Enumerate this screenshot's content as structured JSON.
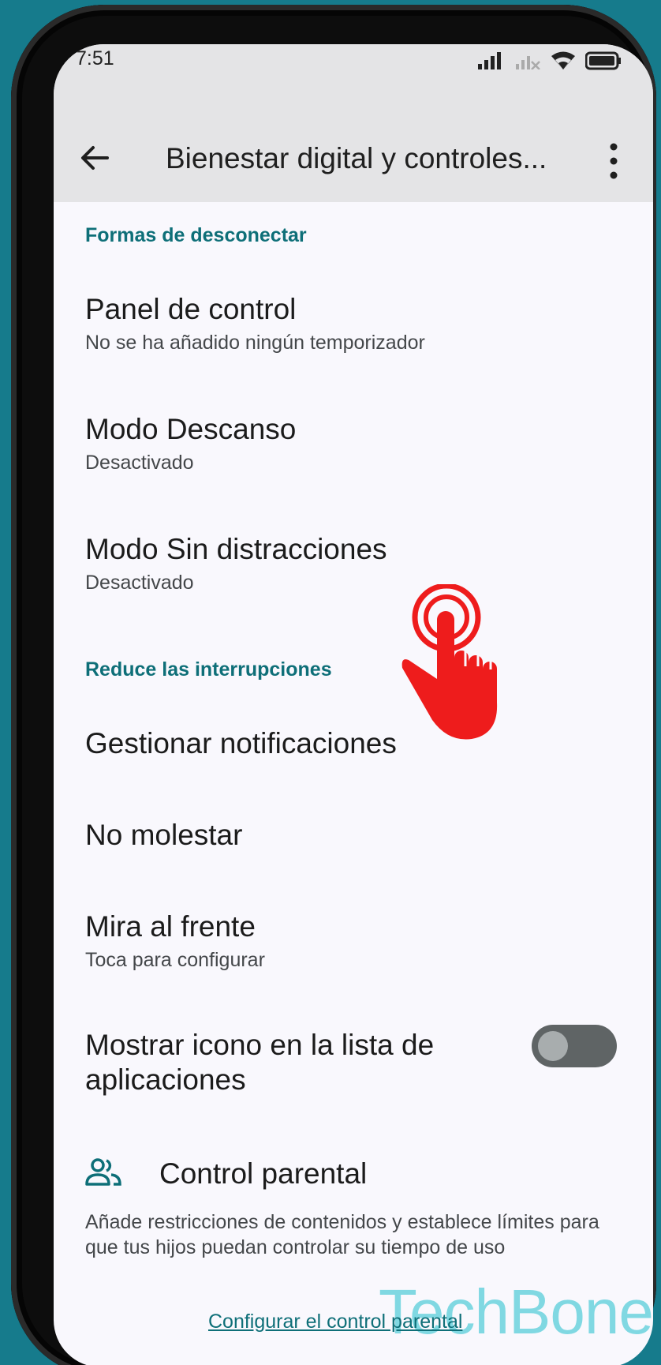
{
  "status_bar": {
    "time": "7:51"
  },
  "app_bar": {
    "title": "Bienestar digital y controles..."
  },
  "sections": [
    {
      "heading": "Formas de desconectar"
    },
    {
      "heading": "Reduce las interrupciones"
    }
  ],
  "items": [
    {
      "title": "Panel de control",
      "subtitle": "No se ha añadido ningún temporizador"
    },
    {
      "title": "Modo Descanso",
      "subtitle": "Desactivado"
    },
    {
      "title": "Modo Sin distracciones",
      "subtitle": "Desactivado"
    },
    {
      "title": "Gestionar notificaciones"
    },
    {
      "title": "No molestar"
    },
    {
      "title": "Mira al frente",
      "subtitle": "Toca para configurar"
    },
    {
      "title": "Mostrar icono en la lista de aplicaciones",
      "toggle_on": false
    }
  ],
  "parental": {
    "title": "Control parental",
    "description": "Añade restricciones de contenidos y establece límites para que tus hijos puedan controlar su tiempo de uso",
    "link": "Configurar el control parental"
  },
  "watermark": "TechBone",
  "colors": {
    "accent": "#0e6f78",
    "background": "#167b8c",
    "tap_indicator": "#ee1c1c"
  },
  "icons": [
    "back-arrow-icon",
    "more-vert-icon",
    "signal-icon",
    "wifi-icon",
    "battery-icon",
    "parental-control-icon",
    "tap-hand-icon"
  ]
}
